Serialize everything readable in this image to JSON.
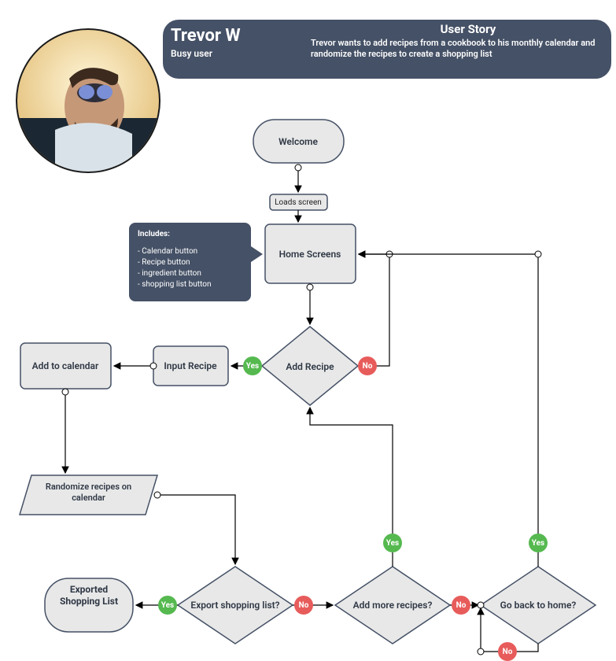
{
  "persona": {
    "name": "Trevor W",
    "role": "Busy user",
    "story_header": "User Story",
    "story_body": "Trevor wants to add recipes from a cookbook to his monthly calendar and randomize the recipes to create a shopping list"
  },
  "callout": {
    "title": "Includes:",
    "items": [
      "- Calendar button",
      "- Recipe button",
      "- ingredient button",
      "- shopping list button"
    ]
  },
  "nodes": {
    "welcome": "Welcome",
    "loads_screen": "Loads screen",
    "home_screens": "Home Screens",
    "add_recipe": "Add Recipe",
    "input_recipe": "Input Recipe",
    "add_to_calendar": "Add to calendar",
    "randomize": "Randomize recipes on calendar",
    "export_q": "Export shopping list?",
    "exported": "Exported Shopping List",
    "add_more": "Add more recipes?",
    "go_home": "Go back to home?"
  },
  "badges": {
    "yes": "Yes",
    "no": "No"
  }
}
